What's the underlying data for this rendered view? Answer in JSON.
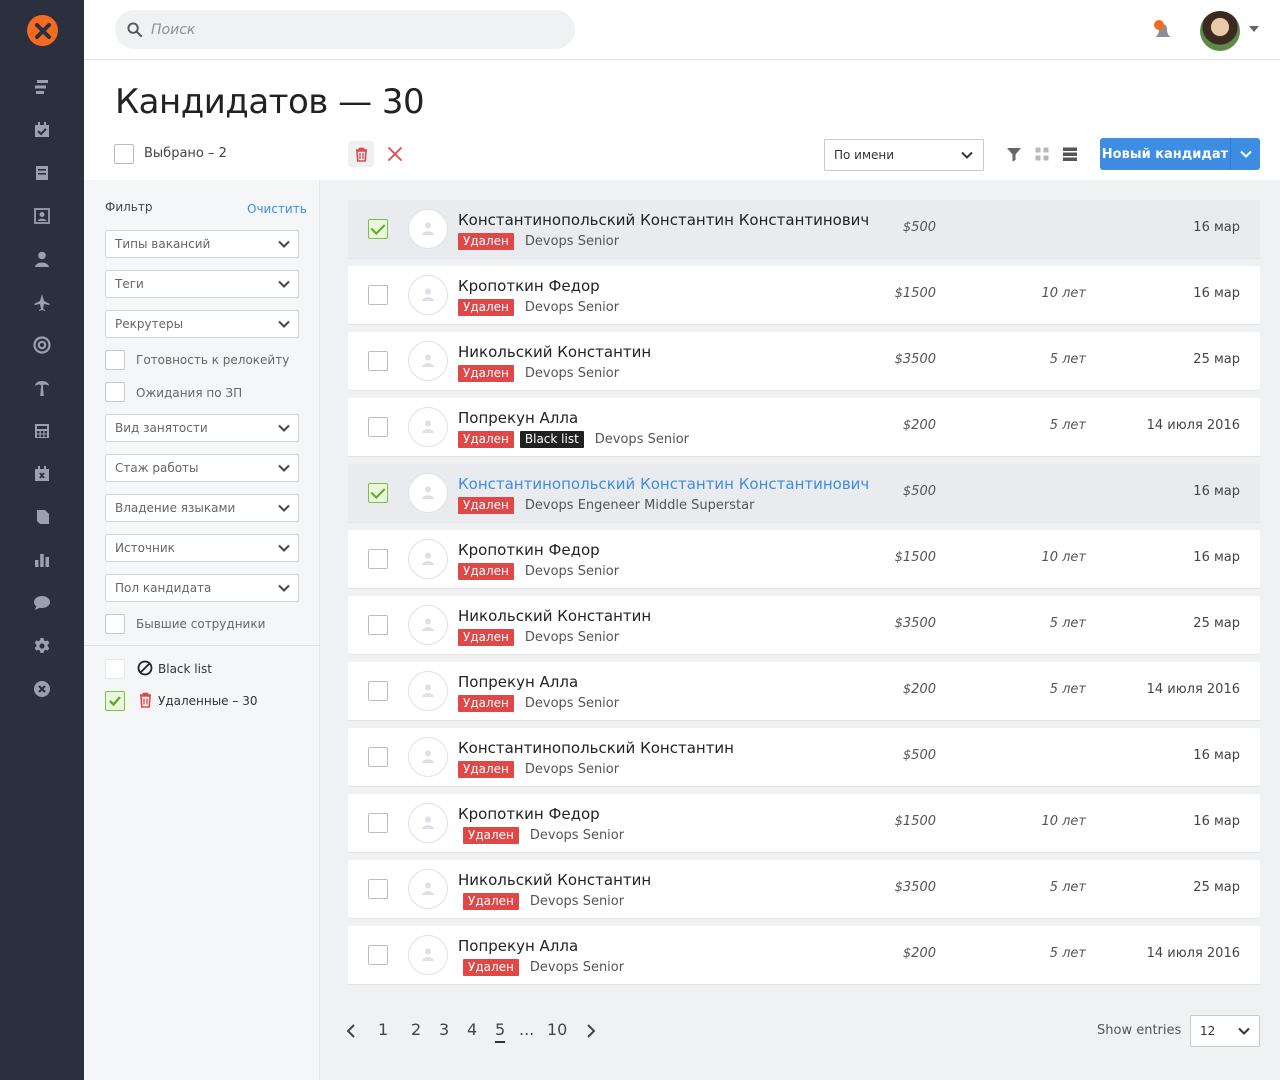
{
  "header": {
    "search_placeholder": "Поиск"
  },
  "page": {
    "title": "Кандидатов — 30",
    "selected_text": "Выбрано – 2",
    "sort_value": "По имени",
    "new_candidate_label": "Новый кандидат"
  },
  "filters": {
    "title": "Фильтр",
    "clear_label": "Очистить",
    "vacancy_types": "Типы вакансий",
    "tags": "Теги",
    "recruiters": "Рекрутеры",
    "relocation": "Готовность к релокейту",
    "salary_expectations": "Ожидания по ЗП",
    "employment_type": "Вид занятости",
    "experience": "Стаж работы",
    "languages": "Владение языками",
    "source": "Источник",
    "gender": "Пол кандидата",
    "former_employees": "Бывшие сотрудники",
    "black_list": "Black list",
    "deleted": "Удаленные – 30"
  },
  "candidates": [
    {
      "name": "Константинопольский Константин Константинович",
      "tag": "Удален",
      "position": "Devops Senior",
      "salary": "$500",
      "experience": "",
      "date": "16 мар",
      "checked": true
    },
    {
      "name": "Кропоткин Федор",
      "tag": "Удален",
      "position": "Devops Senior",
      "salary": "$1500",
      "experience": "10 лет",
      "date": "16 мар",
      "checked": false
    },
    {
      "name": "Никольский Константин",
      "tag": "Удален",
      "position": "Devops Senior",
      "salary": "$3500",
      "experience": "5 лет",
      "date": "25 мар",
      "checked": false
    },
    {
      "name": "Попрекун Алла",
      "tag": "Удален",
      "tag2": "Black list",
      "position": "Devops Senior",
      "salary": "$200",
      "experience": "5 лет",
      "date": "14 июля 2016",
      "checked": false
    },
    {
      "name": "Константинопольский Константин Константинович",
      "tag": "Удален",
      "position": "Devops Engeneer Middle Superstar",
      "salary": "$500",
      "experience": "",
      "date": "16 мар",
      "checked": true
    },
    {
      "name": "Кропоткин Федор",
      "tag": "Удален",
      "position": "Devops Senior",
      "salary": "$1500",
      "experience": "10 лет",
      "date": "16 мар",
      "checked": false
    },
    {
      "name": "Никольский Константин",
      "tag": "Удален",
      "position": "Devops Senior",
      "salary": "$3500",
      "experience": "5 лет",
      "date": "25 мар",
      "checked": false
    },
    {
      "name": "Попрекун Алла",
      "tag": "Удален",
      "position": "Devops Senior",
      "salary": "$200",
      "experience": "5 лет",
      "date": "14 июля 2016",
      "checked": false
    },
    {
      "name": "Константинопольский Константин",
      "tag": "Удален",
      "position": "Devops Senior",
      "salary": "$500",
      "experience": "",
      "date": "16 мар",
      "checked": false
    },
    {
      "name": "Кропоткин Федор",
      "tag": "Удален",
      "position": "Devops Senior",
      "salary": "$1500",
      "experience": "10 лет",
      "date": "16 мар",
      "checked": false
    },
    {
      "name": "Никольский Константин",
      "tag": "Удален",
      "position": "Devops Senior",
      "salary": "$3500",
      "experience": "5 лет",
      "date": "25 мар",
      "checked": false
    },
    {
      "name": "Попрекун Алла",
      "tag": "Удален",
      "position": "Devops Senior",
      "salary": "$200",
      "experience": "5 лет",
      "date": "14 июля 2016",
      "checked": false
    }
  ],
  "pagination": {
    "pages": [
      "1",
      "2",
      "3",
      "4",
      "5",
      "...",
      "10"
    ],
    "current": "5",
    "show_entries_label": "Show entries",
    "entries_value": "12"
  },
  "colors": {
    "accent": "#3d8ee2",
    "deleted_tag": "#e04848",
    "rail": "#2b2f3e",
    "logo": "#f26b21"
  }
}
